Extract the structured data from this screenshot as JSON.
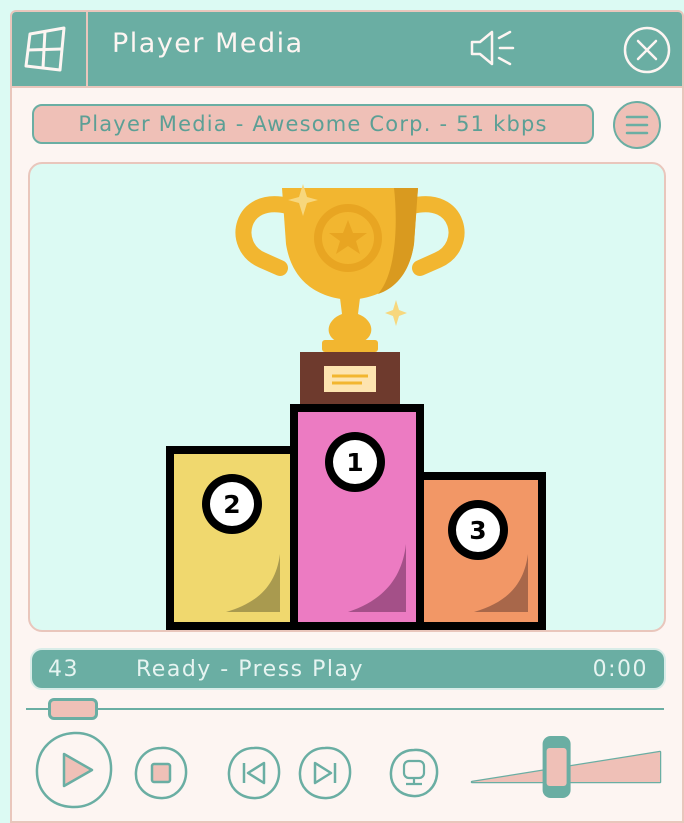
{
  "window": {
    "title": "Player Media",
    "icons": {
      "logo": "windows-logo-icon",
      "sound": "speaker-mute-icon",
      "close": "close-icon"
    }
  },
  "info_bar": {
    "text": "Player Media - Awesome Corp. - 51 kbps",
    "menu_icon": "hamburger-menu-icon"
  },
  "status_bar": {
    "track_number": "43",
    "message": "Ready - Press Play",
    "time": "0:00"
  },
  "seek": {
    "progress": 0.03
  },
  "volume": {
    "level": 0.45
  },
  "controls": [
    {
      "name": "play",
      "icon": "play-icon"
    },
    {
      "name": "stop",
      "icon": "stop-icon"
    },
    {
      "name": "previous",
      "icon": "skip-previous-icon"
    },
    {
      "name": "next",
      "icon": "skip-next-icon"
    },
    {
      "name": "cast",
      "icon": "monitor-icon"
    }
  ],
  "podium": {
    "places": [
      "1",
      "2",
      "3"
    ]
  },
  "colors": {
    "teal": "#6aaea3",
    "pink": "#efc0b7",
    "cream": "#fdf5f2",
    "screen_bg": "#dcfaf3",
    "gold": "#f2b630",
    "place_1": "#ec7bc2",
    "place_2": "#f0d86e",
    "place_3": "#f29766"
  }
}
